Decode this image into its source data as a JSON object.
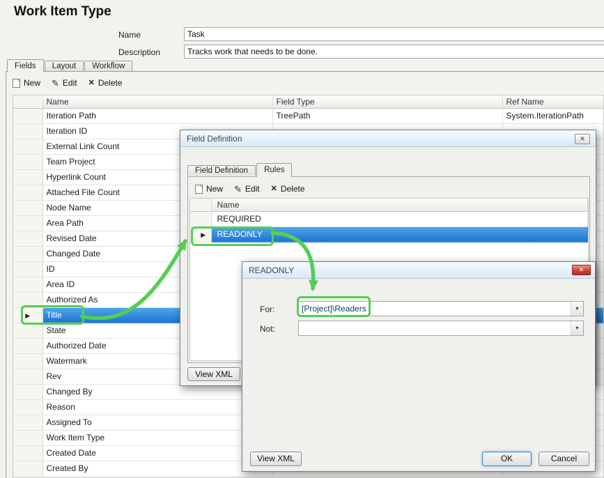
{
  "window": {
    "title": "Work Item Type"
  },
  "form": {
    "name": {
      "label": "Name",
      "value": "Task"
    },
    "description": {
      "label": "Description",
      "value": "Tracks work that needs to be done."
    }
  },
  "tabs": {
    "fields": "Fields",
    "layout": "Layout",
    "workflow": "Workflow"
  },
  "toolbar": {
    "new": "New",
    "edit": "Edit",
    "delete": "Delete"
  },
  "icons": {
    "row_marker": "▶",
    "edit": "✎",
    "delete": "✕",
    "close": "✕",
    "dropdown": "▼"
  },
  "fields_table": {
    "headers": {
      "name": "Name",
      "field_type": "Field Type",
      "ref_name": "Ref Name"
    },
    "selected": "Title",
    "rows": [
      {
        "name": "Iteration Path",
        "field_type": "TreePath",
        "ref_name": "System.IterationPath"
      },
      {
        "name": "Iteration ID",
        "field_type": "",
        "ref_name": ""
      },
      {
        "name": "External Link Count",
        "field_type": "",
        "ref_name": ""
      },
      {
        "name": "Team Project",
        "field_type": "",
        "ref_name": ""
      },
      {
        "name": "Hyperlink Count",
        "field_type": "",
        "ref_name": ""
      },
      {
        "name": "Attached File Count",
        "field_type": "",
        "ref_name": ""
      },
      {
        "name": "Node Name",
        "field_type": "",
        "ref_name": ""
      },
      {
        "name": "Area Path",
        "field_type": "",
        "ref_name": ""
      },
      {
        "name": "Revised Date",
        "field_type": "",
        "ref_name": ""
      },
      {
        "name": "Changed Date",
        "field_type": "",
        "ref_name": ""
      },
      {
        "name": "ID",
        "field_type": "",
        "ref_name": ""
      },
      {
        "name": "Area ID",
        "field_type": "",
        "ref_name": ""
      },
      {
        "name": "Authorized As",
        "field_type": "",
        "ref_name": ""
      },
      {
        "name": "Title",
        "field_type": "",
        "ref_name": ""
      },
      {
        "name": "State",
        "field_type": "",
        "ref_name": ""
      },
      {
        "name": "Authorized Date",
        "field_type": "",
        "ref_name": ""
      },
      {
        "name": "Watermark",
        "field_type": "",
        "ref_name": ""
      },
      {
        "name": "Rev",
        "field_type": "",
        "ref_name": ""
      },
      {
        "name": "Changed By",
        "field_type": "",
        "ref_name": ""
      },
      {
        "name": "Reason",
        "field_type": "",
        "ref_name": ""
      },
      {
        "name": "Assigned To",
        "field_type": "",
        "ref_name": ""
      },
      {
        "name": "Work Item Type",
        "field_type": "",
        "ref_name": ""
      },
      {
        "name": "Created Date",
        "field_type": "",
        "ref_name": ""
      },
      {
        "name": "Created By",
        "field_type": "",
        "ref_name": ""
      }
    ]
  },
  "field_definition_dialog": {
    "title": "Field Definition",
    "tabs": {
      "field_definition": "Field Definition",
      "rules": "Rules"
    },
    "toolbar": {
      "new": "New",
      "edit": "Edit",
      "delete": "Delete"
    },
    "rules_table": {
      "headers": {
        "name": "Name"
      },
      "selected": "READONLY",
      "rows": [
        {
          "name": "REQUIRED"
        },
        {
          "name": "READONLY"
        }
      ]
    },
    "view_xml_label": "View XML"
  },
  "readonly_dialog": {
    "title": "READONLY",
    "for": {
      "label": "For:",
      "value": "[Project]\\Readers"
    },
    "not": {
      "label": "Not:",
      "value": ""
    },
    "view_xml_label": "View XML",
    "ok_label": "OK",
    "cancel_label": "Cancel"
  }
}
